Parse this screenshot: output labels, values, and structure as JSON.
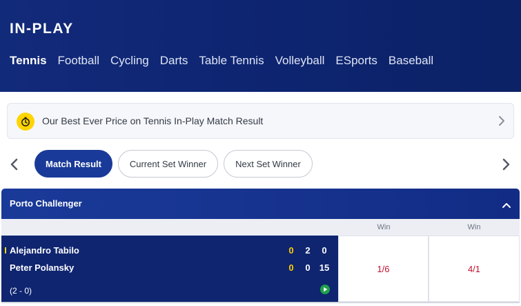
{
  "header": {
    "title": "IN-PLAY",
    "sports": [
      {
        "label": "Tennis",
        "active": true
      },
      {
        "label": "Football"
      },
      {
        "label": "Cycling"
      },
      {
        "label": "Darts"
      },
      {
        "label": "Table Tennis"
      },
      {
        "label": "Volleyball"
      },
      {
        "label": "ESports"
      },
      {
        "label": "Baseball"
      }
    ]
  },
  "promo": {
    "icon": "stopwatch-icon",
    "text": "Our Best Ever Price on Tennis In-Play Match Result"
  },
  "market_tabs": [
    {
      "label": "Match Result",
      "active": true
    },
    {
      "label": "Current Set Winner"
    },
    {
      "label": "Next Set Winner"
    }
  ],
  "event": {
    "title": "Porto Challenger",
    "columns": [
      "Win",
      "Win"
    ],
    "match": {
      "players": [
        {
          "name": "Alejandro Tabilo",
          "scores": [
            "0",
            "2",
            "0"
          ],
          "serving": true
        },
        {
          "name": "Peter Polansky",
          "scores": [
            "0",
            "0",
            "15"
          ]
        }
      ],
      "sets": "(2 - 0)",
      "odds": [
        "1/6",
        "4/1"
      ]
    }
  },
  "colors": {
    "header_bg": "#0d2470",
    "accent_blue": "#1a3a99",
    "promo_yellow": "#ffd400",
    "odds_red": "#c0102c",
    "score_yellow": "#ffcc00",
    "live_green": "#1fa04a"
  }
}
